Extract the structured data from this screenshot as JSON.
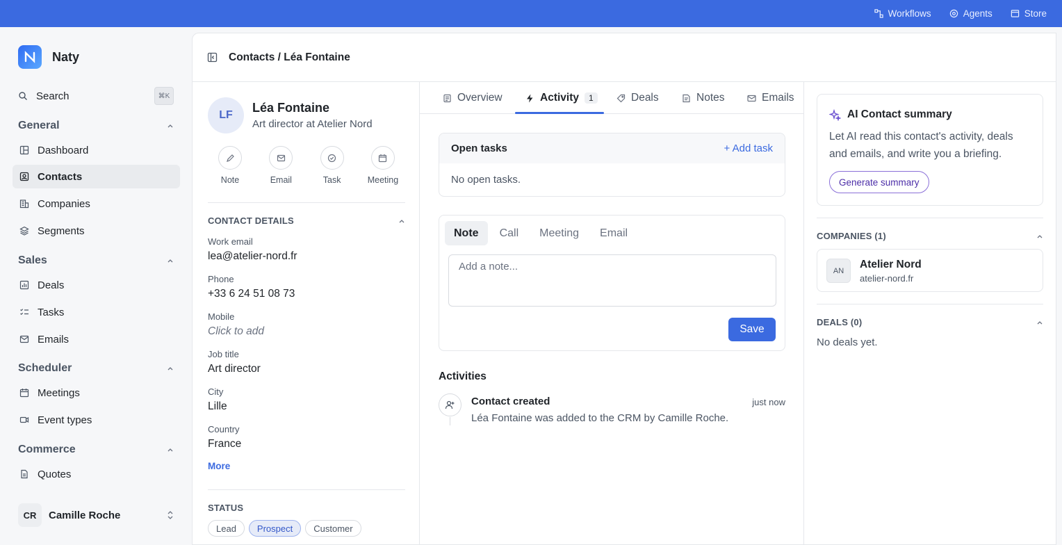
{
  "topbar": {
    "links": [
      {
        "label": "Workflows",
        "icon": "workflow-icon"
      },
      {
        "label": "Agents",
        "icon": "agent-icon"
      },
      {
        "label": "Store",
        "icon": "store-icon"
      }
    ]
  },
  "sidebar": {
    "brand": "Naty",
    "search": {
      "label": "Search",
      "shortcut": "⌘K"
    },
    "sections": {
      "general": "General",
      "sales": "Sales",
      "scheduler": "Scheduler",
      "commerce": "Commerce"
    },
    "items": {
      "dashboard": "Dashboard",
      "contacts": "Contacts",
      "companies": "Companies",
      "segments": "Segments",
      "deals": "Deals",
      "tasks": "Tasks",
      "emails": "Emails",
      "meetings": "Meetings",
      "event_types": "Event types",
      "quotes": "Quotes"
    },
    "user": {
      "initials": "CR",
      "name": "Camille Roche"
    }
  },
  "header": {
    "breadcrumb": "Contacts / Léa Fontaine"
  },
  "contact": {
    "initials": "LF",
    "name": "Léa Fontaine",
    "subtitle": "Art director at Atelier Nord",
    "actions": {
      "note": "Note",
      "email": "Email",
      "task": "Task",
      "meeting": "Meeting"
    },
    "details_title": "CONTACT DETAILS",
    "fields": [
      {
        "label": "Work email",
        "value": "lea@atelier-nord.fr"
      },
      {
        "label": "Phone",
        "value": "+33 6 24 51 08 73"
      },
      {
        "label": "Mobile",
        "value": "Click to add"
      },
      {
        "label": "Job title",
        "value": "Art director"
      },
      {
        "label": "City",
        "value": "Lille"
      },
      {
        "label": "Country",
        "value": "France"
      }
    ],
    "more": "More",
    "status_title": "STATUS",
    "status_options": [
      "Lead",
      "Prospect",
      "Customer"
    ],
    "status_selected": "Prospect"
  },
  "tabs": {
    "overview": "Overview",
    "activity": "Activity",
    "activity_count": "1",
    "deals": "Deals",
    "notes": "Notes",
    "emails": "Emails"
  },
  "open_tasks": {
    "title": "Open tasks",
    "add": "+ Add task",
    "empty": "No open tasks."
  },
  "composer": {
    "tabs": [
      "Note",
      "Call",
      "Meeting",
      "Email"
    ],
    "placeholder": "Add a note...",
    "save": "Save"
  },
  "activities": {
    "title": "Activities",
    "items": [
      {
        "title": "Contact created",
        "time": "just now",
        "desc": "Léa Fontaine was added to the CRM by Camille Roche."
      }
    ]
  },
  "ai": {
    "title": "AI Contact summary",
    "desc": "Let AI read this contact's activity, deals and emails, and write you a briefing.",
    "button": "Generate summary"
  },
  "companies": {
    "title": "COMPANIES (1)",
    "items": [
      {
        "initials": "AN",
        "name": "Atelier Nord",
        "domain": "atelier-nord.fr"
      }
    ]
  },
  "deals": {
    "title": "DEALS (0)",
    "empty": "No deals yet."
  },
  "colors": {
    "accent": "#3b6ae0",
    "topbar": "#3b6ae0"
  }
}
